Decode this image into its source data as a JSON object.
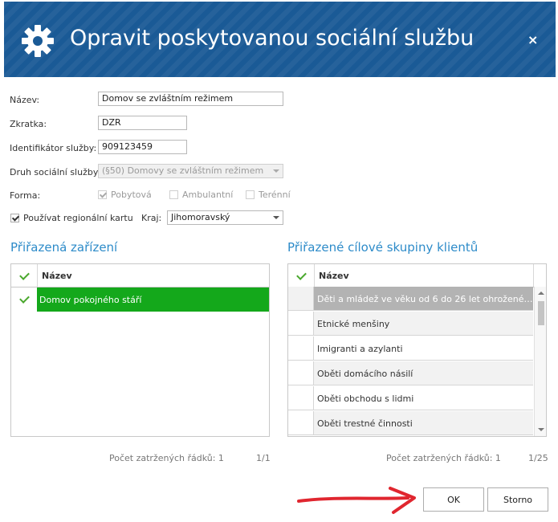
{
  "dialog": {
    "title": "Opravit poskytovanou sociální službu",
    "close_label": "×",
    "accent_color": "#1a5a96"
  },
  "form": {
    "nazev_label": "Název:",
    "nazev_value": "Domov se zvláštním režimem",
    "zkratka_label": "Zkratka:",
    "zkratka_value": "DZR",
    "identifikator_label": "Identifikátor služby:",
    "identifikator_value": "909123459",
    "druh_label": "Druh sociální služby:",
    "druh_value": "(§50) Domovy se zvláštním režimem",
    "forma_label": "Forma:",
    "forma_options": [
      {
        "label": "Pobytová",
        "checked": true
      },
      {
        "label": "Ambulantní",
        "checked": false
      },
      {
        "label": "Terénní",
        "checked": false
      }
    ],
    "regional_label": "Používat regionální kartu",
    "regional_checked": true,
    "kraj_label": "Kraj:",
    "kraj_value": "Jihomoravský"
  },
  "left_panel": {
    "title": "Přiřazená zařízení",
    "column_header": "Název",
    "rows": [
      {
        "label": "Domov pokojného stáří",
        "checked": true,
        "selected": true
      }
    ],
    "footer_count": "Počet zatržených řádků: 1",
    "footer_page": "1/1"
  },
  "right_panel": {
    "title": "Přiřazené cílové skupiny klientů",
    "column_header": "Název",
    "rows": [
      {
        "label": "Děti a mládež ve věku od 6 do 26 let ohrožené…",
        "checked": false,
        "highlighted": true
      },
      {
        "label": "Etnické menšiny",
        "checked": false
      },
      {
        "label": "Imigranti a azylanti",
        "checked": false
      },
      {
        "label": "Oběti domácího násilí",
        "checked": false
      },
      {
        "label": "Oběti obchodu s lidmi",
        "checked": false
      },
      {
        "label": "Oběti trestné činnosti",
        "checked": false
      }
    ],
    "footer_count": "Počet zatržených řádků: 1",
    "footer_page": "1/25"
  },
  "buttons": {
    "ok_label": "OK",
    "cancel_label": "Storno"
  },
  "icons": {
    "title_icon": "gear-icon",
    "close_icon": "close-icon",
    "annotation": "red-arrow-icon"
  }
}
